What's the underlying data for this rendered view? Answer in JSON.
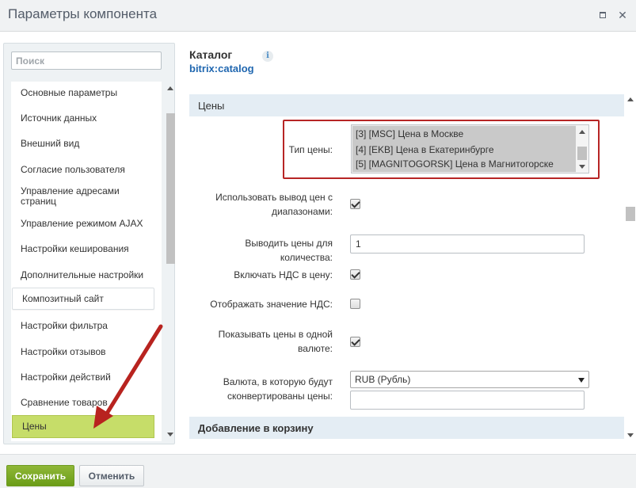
{
  "window": {
    "title": "Параметры компонента",
    "maximize_icon": "maximize-icon",
    "close_glyph": "✕"
  },
  "sidebar": {
    "search_placeholder": "Поиск",
    "items": [
      {
        "label": "Основные параметры"
      },
      {
        "label": "Источник данных"
      },
      {
        "label": "Внешний вид"
      },
      {
        "label": "Согласие пользователя"
      },
      {
        "label": "Управление адресами страниц"
      },
      {
        "label": "Управление режимом AJAX"
      },
      {
        "label": "Настройки кеширования"
      },
      {
        "label": "Дополнительные настройки"
      },
      {
        "label": "Композитный сайт"
      },
      {
        "label": "Настройки фильтра"
      },
      {
        "label": "Настройки отзывов"
      },
      {
        "label": "Настройки действий"
      },
      {
        "label": "Сравнение товаров"
      },
      {
        "label": "Цены"
      }
    ],
    "active_item": "Цены",
    "active_color": "#c6dd69"
  },
  "component": {
    "title": "Каталог",
    "code": "bitrix:catalog",
    "info_glyph": "i"
  },
  "sections": {
    "prices": "Цены",
    "cart": "Добавление в корзину"
  },
  "form": {
    "price_type_label": "Тип цены:",
    "price_type_options": [
      "[3] [MSC] Цена в Москве",
      "[4] [EKB] Цена в Екатеринбурге",
      "[5] [MAGNITOGORSK] Цена в Магнитогорске"
    ],
    "use_ranges_label": "Использовать вывод цен с диапазонами:",
    "use_ranges_checked": true,
    "show_price_count_label": "Выводить цены для количества:",
    "show_price_count_value": "1",
    "include_vat_label": "Включать НДС в цену:",
    "include_vat_checked": true,
    "show_vat_label": "Отображать значение НДС:",
    "show_vat_checked": false,
    "one_currency_label": "Показывать цены в одной валюте:",
    "one_currency_checked": true,
    "currency_label": "Валюта, в которую будут сконвертированы цены:",
    "currency_value": "RUB (Рубль)",
    "currency_extra_value": ""
  },
  "footer": {
    "save_label": "Сохранить",
    "cancel_label": "Отменить"
  },
  "colors": {
    "highlight_border": "#b72525",
    "annotation_arrow": "#b8231f",
    "save_button": "#7aa927",
    "link_blue": "#2067b0"
  }
}
